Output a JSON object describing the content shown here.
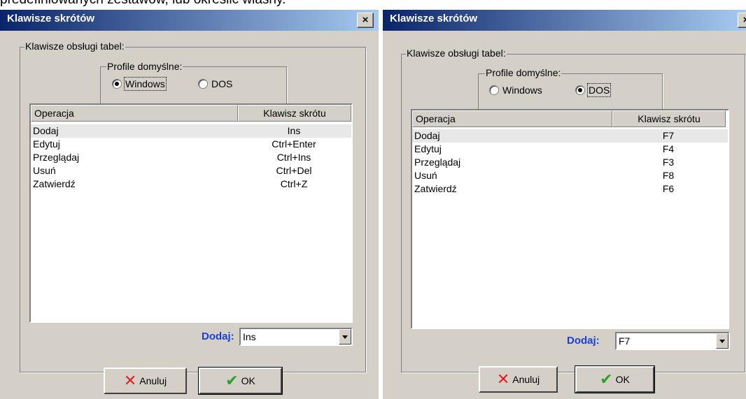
{
  "top_text": "predefiniowanych zestawów, lub określić własny.",
  "dialogs": [
    {
      "title": "Klawisze skrótów",
      "close_label": "×",
      "group_label": "Klawisze obsługi tabel:",
      "profile_label": "Profile domyślne:",
      "profiles": [
        {
          "label": "Windows",
          "selected": true
        },
        {
          "label": "DOS",
          "selected": false
        }
      ],
      "columns": [
        "Operacja",
        "Klawisz skrótu"
      ],
      "rows": [
        {
          "op": "Dodaj",
          "key": "Ins"
        },
        {
          "op": "Edytuj",
          "key": "Ctrl+Enter"
        },
        {
          "op": "Przeglądaj",
          "key": "Ctrl+Ins"
        },
        {
          "op": "Usuń",
          "key": "Ctrl+Del"
        },
        {
          "op": "Zatwierdź",
          "key": "Ctrl+Z"
        }
      ],
      "selected_row": 0,
      "dodaj_label": "Dodaj:",
      "combo_value": "Ins",
      "cancel_label": "Anuluj",
      "ok_label": "OK"
    },
    {
      "title": "Klawisze skrótów",
      "close_label": "×",
      "group_label": "Klawisze obsługi tabel:",
      "profile_label": "Profile domyślne:",
      "profiles": [
        {
          "label": "Windows",
          "selected": false
        },
        {
          "label": "DOS",
          "selected": true
        }
      ],
      "columns": [
        "Operacja",
        "Klawisz skrótu"
      ],
      "rows": [
        {
          "op": "Dodaj",
          "key": "F7"
        },
        {
          "op": "Edytuj",
          "key": "F4"
        },
        {
          "op": "Przeglądaj",
          "key": "F3"
        },
        {
          "op": "Usuń",
          "key": "F8"
        },
        {
          "op": "Zatwierdź",
          "key": "F6"
        }
      ],
      "selected_row": 0,
      "dodaj_label": "Dodaj:",
      "combo_value": "F7",
      "cancel_label": "Anuluj",
      "ok_label": "OK"
    }
  ],
  "icons": {
    "cancel": "x-icon",
    "ok": "check-icon"
  },
  "colors": {
    "title_start": "#0a246a",
    "title_end": "#a6caf0",
    "dodaj_label": "#1a3fd4",
    "face": "#d4d0c8"
  }
}
